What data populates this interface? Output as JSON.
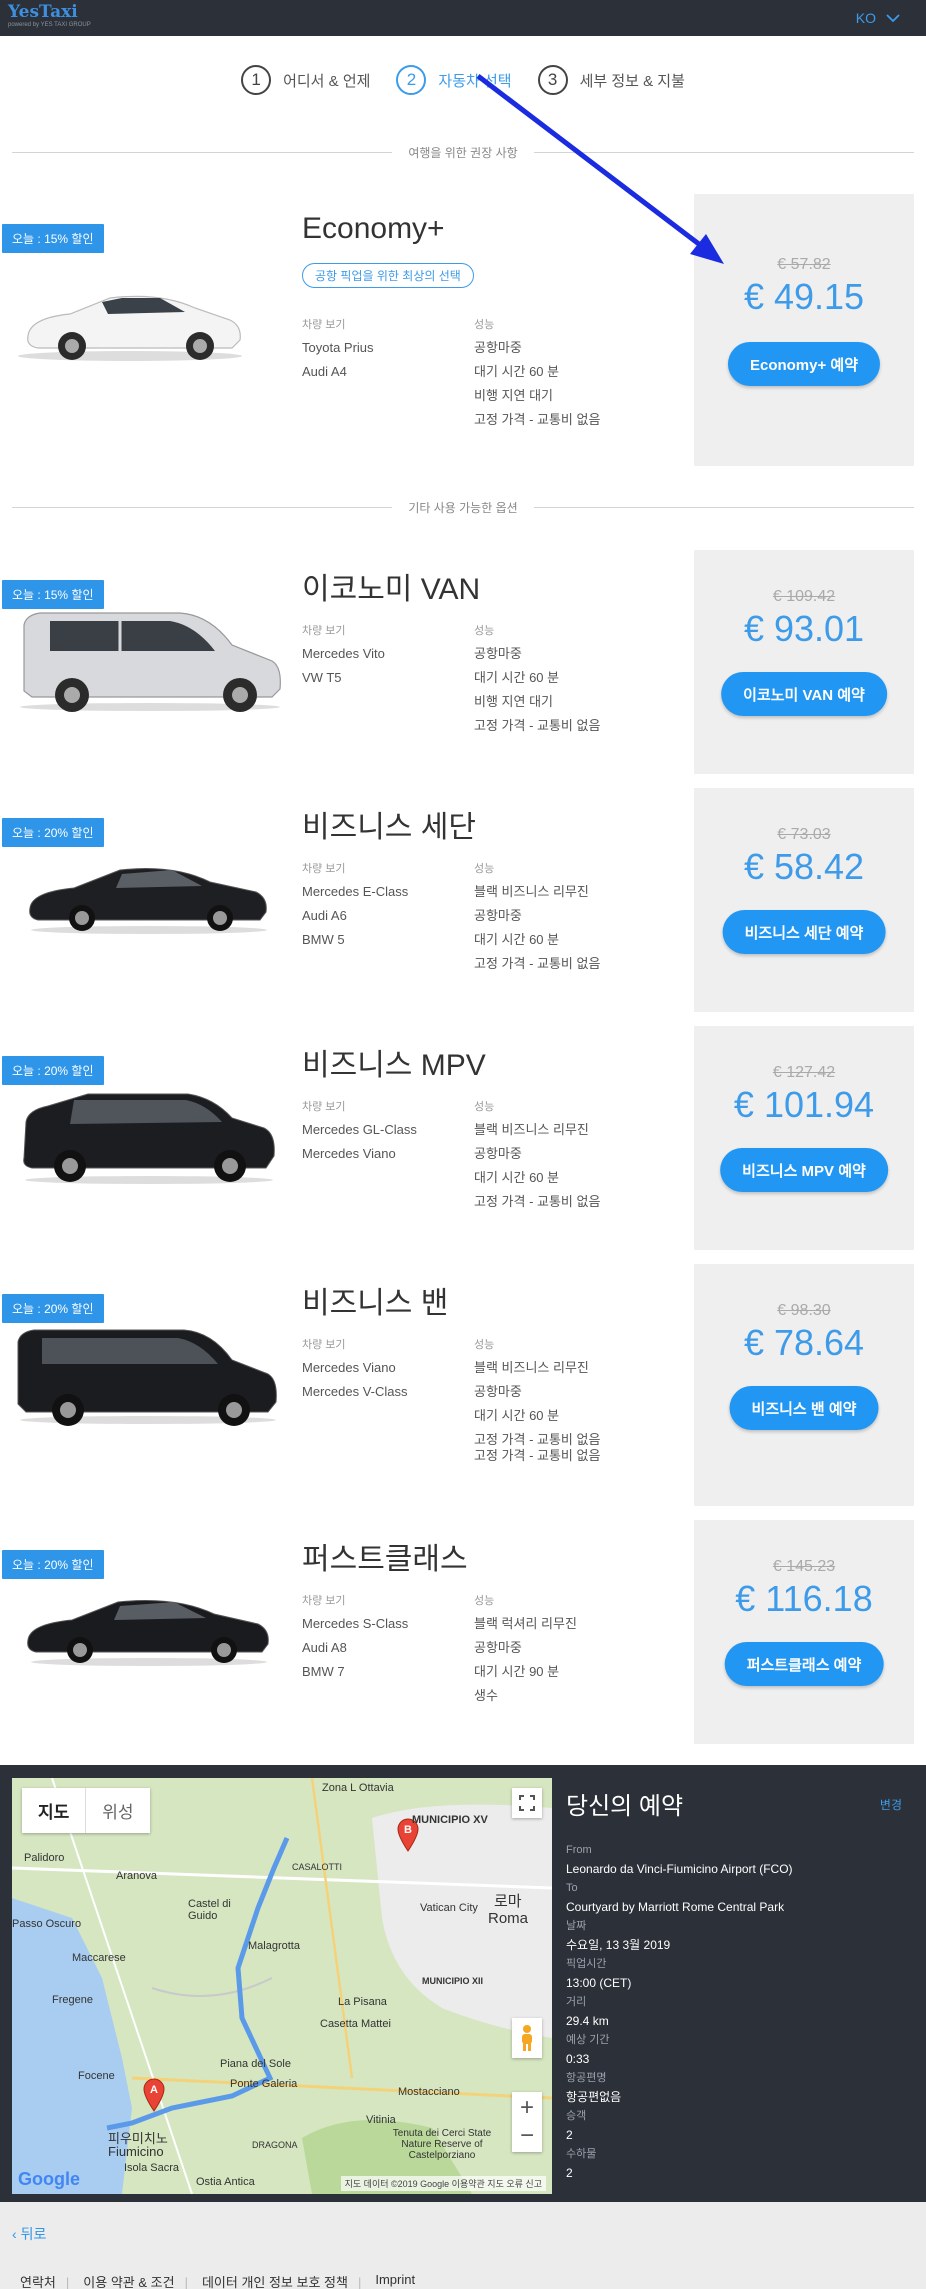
{
  "header": {
    "logo_name": "YesTaxi",
    "logo_sub": "powered by YES TAXI GROUP",
    "language": "KO"
  },
  "steps": [
    {
      "num": "1",
      "label": "어디서 & 언제"
    },
    {
      "num": "2",
      "label": "자동차 선택"
    },
    {
      "num": "3",
      "label": "세부 정보 & 지불"
    }
  ],
  "sections": {
    "recommended": "여행을 위한 권장 사항",
    "other": "기타 사용 가능한 옵션"
  },
  "vehicles": [
    {
      "badge": "오늘 : 15% 할인",
      "title": "Economy+",
      "tagline": "공항 픽업을 위한 최상의 선택",
      "models_head": "차량 보기",
      "models": [
        "Toyota Prius",
        "Audi A4"
      ],
      "features_head": "성능",
      "features": [
        "공항마중",
        "대기 시간 60 분",
        "비행 지연 대기",
        "고정 가격 - 교통비 없음"
      ],
      "old_price": "€ 57.82",
      "price": "€ 49.15",
      "button": "Economy+ 예약"
    },
    {
      "badge": "오늘 : 15% 할인",
      "title": "이코노미 VAN",
      "models_head": "차량 보기",
      "models": [
        "Mercedes Vito",
        "VW T5"
      ],
      "features_head": "성능",
      "features": [
        "공항마중",
        "대기 시간 60 분",
        "비행 지연 대기",
        "고정 가격 - 교통비 없음"
      ],
      "old_price": "€ 109.42",
      "price": "€ 93.01",
      "button": "이코노미 VAN 예약"
    },
    {
      "badge": "오늘 : 20% 할인",
      "title": "비즈니스 세단",
      "models_head": "차량 보기",
      "models": [
        "Mercedes E-Class",
        "Audi A6",
        "BMW 5"
      ],
      "features_head": "성능",
      "features": [
        "블랙 비즈니스 리무진",
        "공항마중",
        "대기 시간 60 분",
        "고정 가격 - 교통비 없음"
      ],
      "old_price": "€ 73.03",
      "price": "€ 58.42",
      "button": "비즈니스 세단 예약"
    },
    {
      "badge": "오늘 : 20% 할인",
      "title": "비즈니스 MPV",
      "models_head": "차량 보기",
      "models": [
        "Mercedes GL-Class",
        "Mercedes Viano"
      ],
      "features_head": "성능",
      "features": [
        "블랙 비즈니스 리무진",
        "공항마중",
        "대기 시간 60 분",
        "고정 가격 - 교통비 없음"
      ],
      "old_price": "€ 127.42",
      "price": "€ 101.94",
      "button": "비즈니스 MPV 예약"
    },
    {
      "badge": "오늘 : 20% 할인",
      "title": "비즈니스 밴",
      "models_head": "차량 보기",
      "models": [
        "Mercedes Viano",
        "Mercedes V-Class"
      ],
      "features_head": "성능",
      "features": [
        "블랙 비즈니스 리무진",
        "공항마중",
        "대기 시간 60 분",
        "고정 가격 - 교통비 없음",
        "고정 가격 - 교통비 없음"
      ],
      "old_price": "€ 98.30",
      "price": "€ 78.64",
      "button": "비즈니스 밴 예약"
    },
    {
      "badge": "오늘 : 20% 할인",
      "title": "퍼스트클래스",
      "models_head": "차량 보기",
      "models": [
        "Mercedes S-Class",
        "Audi A8",
        "BMW 7"
      ],
      "features_head": "성능",
      "features": [
        "블랙 럭셔리 리무진",
        "공항마중",
        "대기 시간 90 분",
        "생수"
      ],
      "old_price": "€ 145.23",
      "price": "€ 116.18",
      "button": "퍼스트클래스 예약"
    }
  ],
  "map": {
    "tab_map": "지도",
    "tab_satellite": "위성",
    "labels": {
      "zona": "Zona L Ottavia",
      "municipio_xv": "MUNICIPIO XV",
      "palidoro": "Palidoro",
      "aranova": "Aranova",
      "casalotti": "CASALOTTI",
      "castel": "Castel di Guido",
      "vatican": "Vatican City",
      "roma_ko": "로마",
      "roma": "Roma",
      "oscuro": "Passo Oscuro",
      "maccarese": "Maccarese",
      "malagrotta": "Malagrotta",
      "fregene": "Fregene",
      "mun_xii": "MUNICIPIO XII",
      "pisana": "La Pisana",
      "mattei": "Casetta Mattei",
      "focene": "Focene",
      "piana": "Piana del Sole",
      "galeria": "Ponte Galeria",
      "mostacciano": "Mostacciano",
      "vitinia": "Vitinia",
      "fiumicino_ko": "피우미치노",
      "fiumicino": "Fiumicino",
      "isola": "Isola Sacra",
      "ostia": "Ostia Antica",
      "cerci": "Tenuta dei Cerci State Nature Reserve of Castelporziano",
      "dragona": "DRAGONA"
    },
    "google": "Google",
    "attribution": "지도 데이터 ©2019 Google   이용약관   지도 오류 신고"
  },
  "booking": {
    "title": "당신의 예약",
    "change": "변경",
    "rows": [
      {
        "label": "From",
        "value": "Leonardo da Vinci-Fiumicino Airport (FCO)"
      },
      {
        "label": "To",
        "value": "Courtyard by Marriott Rome Central Park"
      },
      {
        "label": "날짜",
        "value": "수요일, 13 3월 2019"
      },
      {
        "label": "픽업시간",
        "value": "13:00 (CET)"
      },
      {
        "label": "거리",
        "value": "29.4 km"
      },
      {
        "label": "예상 기간",
        "value": "0:33"
      },
      {
        "label": "항공편명",
        "value": "항공편없음"
      },
      {
        "label": "승객",
        "value": "2"
      },
      {
        "label": "수하물",
        "value": "2"
      }
    ]
  },
  "footer": {
    "back": "뒤로",
    "links": [
      "연락처",
      "이용 약관 & 조건",
      "데이터 개인 정보 보호 정책",
      "Imprint"
    ]
  },
  "colors": {
    "accent": "#2196f3",
    "header_bg": "#2c3038",
    "arrow": "#1b2be0"
  }
}
